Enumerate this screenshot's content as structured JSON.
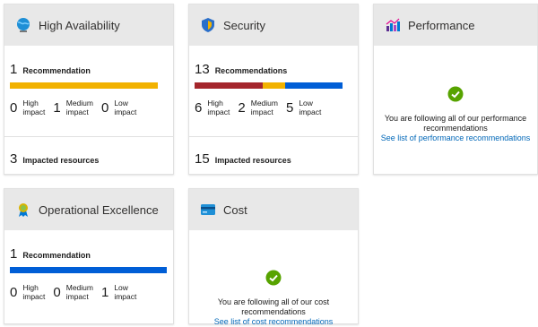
{
  "colors": {
    "high": "#a4262c",
    "medium": "#f2b200",
    "low": "#005ed6",
    "link": "#0067b8",
    "success": "#57a300"
  },
  "cards": {
    "high_availability": {
      "title": "High Availability",
      "icon": "globe-icon",
      "rec_count": "1",
      "rec_label": "Recommendation",
      "high": "0",
      "medium": "1",
      "low": "0",
      "resources_count": "3",
      "resources_label": "Impacted resources"
    },
    "security": {
      "title": "Security",
      "icon": "shield-icon",
      "rec_count": "13",
      "rec_label": "Recommendations",
      "high": "6",
      "medium": "2",
      "low": "5",
      "resources_count": "15",
      "resources_label": "Impacted resources"
    },
    "performance": {
      "title": "Performance",
      "icon": "performance-chart-icon",
      "following_line1": "You are following all of our performance",
      "following_line2": "recommendations",
      "link": "See list of performance recommendations"
    },
    "operational_excellence": {
      "title": "Operational Excellence",
      "icon": "award-ribbon-icon",
      "rec_count": "1",
      "rec_label": "Recommendation",
      "high": "0",
      "medium": "0",
      "low": "1"
    },
    "cost": {
      "title": "Cost",
      "icon": "credit-card-icon",
      "following_line1": "You are following all of our cost",
      "following_line2": "recommendations",
      "link": "See list of cost recommendations"
    }
  },
  "labels": {
    "high_l1": "High",
    "high_l2": "impact",
    "medium_l1": "Medium",
    "medium_l2": "impact",
    "low_l1": "Low",
    "low_l2": "impact"
  }
}
